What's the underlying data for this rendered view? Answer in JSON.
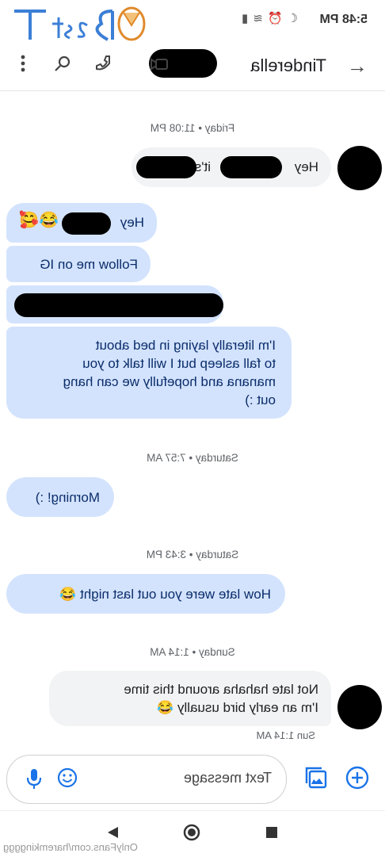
{
  "status_bar": {
    "time": "5:48 PM"
  },
  "watermark": {
    "logo_text": "BestThot",
    "footer": "OnlyFans.com/haremkingggg"
  },
  "header": {
    "contact_name": "Tinderella"
  },
  "messages": [
    {
      "date": "Friday • 11:08 PM"
    },
    {
      "text": "Hey",
      "text2": "it's"
    },
    {
      "text": "Hey"
    },
    {
      "text": "Follow me on IG"
    },
    {
      "text": "I'm literally laying in bed about\nto fall asleep but I will talk to you\nmanana and hopefully we can hang\nout :)"
    },
    {
      "date": "Saturday • 7:57 AM"
    },
    {
      "text": "Morning! :)"
    },
    {
      "date": "Saturday • 3:43 PM"
    },
    {
      "text": "How late were you out last night 😂"
    },
    {
      "date": "Sunday • 1:14 AM"
    },
    {
      "text": "Not late hahaha around this time\nI'm an early bird usually 😂",
      "meta": "Sun 1:14 AM"
    }
  ],
  "composer": {
    "placeholder": "Text message"
  },
  "colors": {
    "incoming": "#d3e3fd",
    "outgoing": "#f1f3f4",
    "accent": "#1a73e8"
  },
  "icons": [
    "back-arrow-icon",
    "video-call-icon",
    "phone-icon",
    "search-icon",
    "more-vert-icon",
    "emoji-icon",
    "mic-icon",
    "gallery-icon",
    "add-icon",
    "nav-back-icon",
    "nav-home-icon",
    "nav-recents-icon"
  ]
}
